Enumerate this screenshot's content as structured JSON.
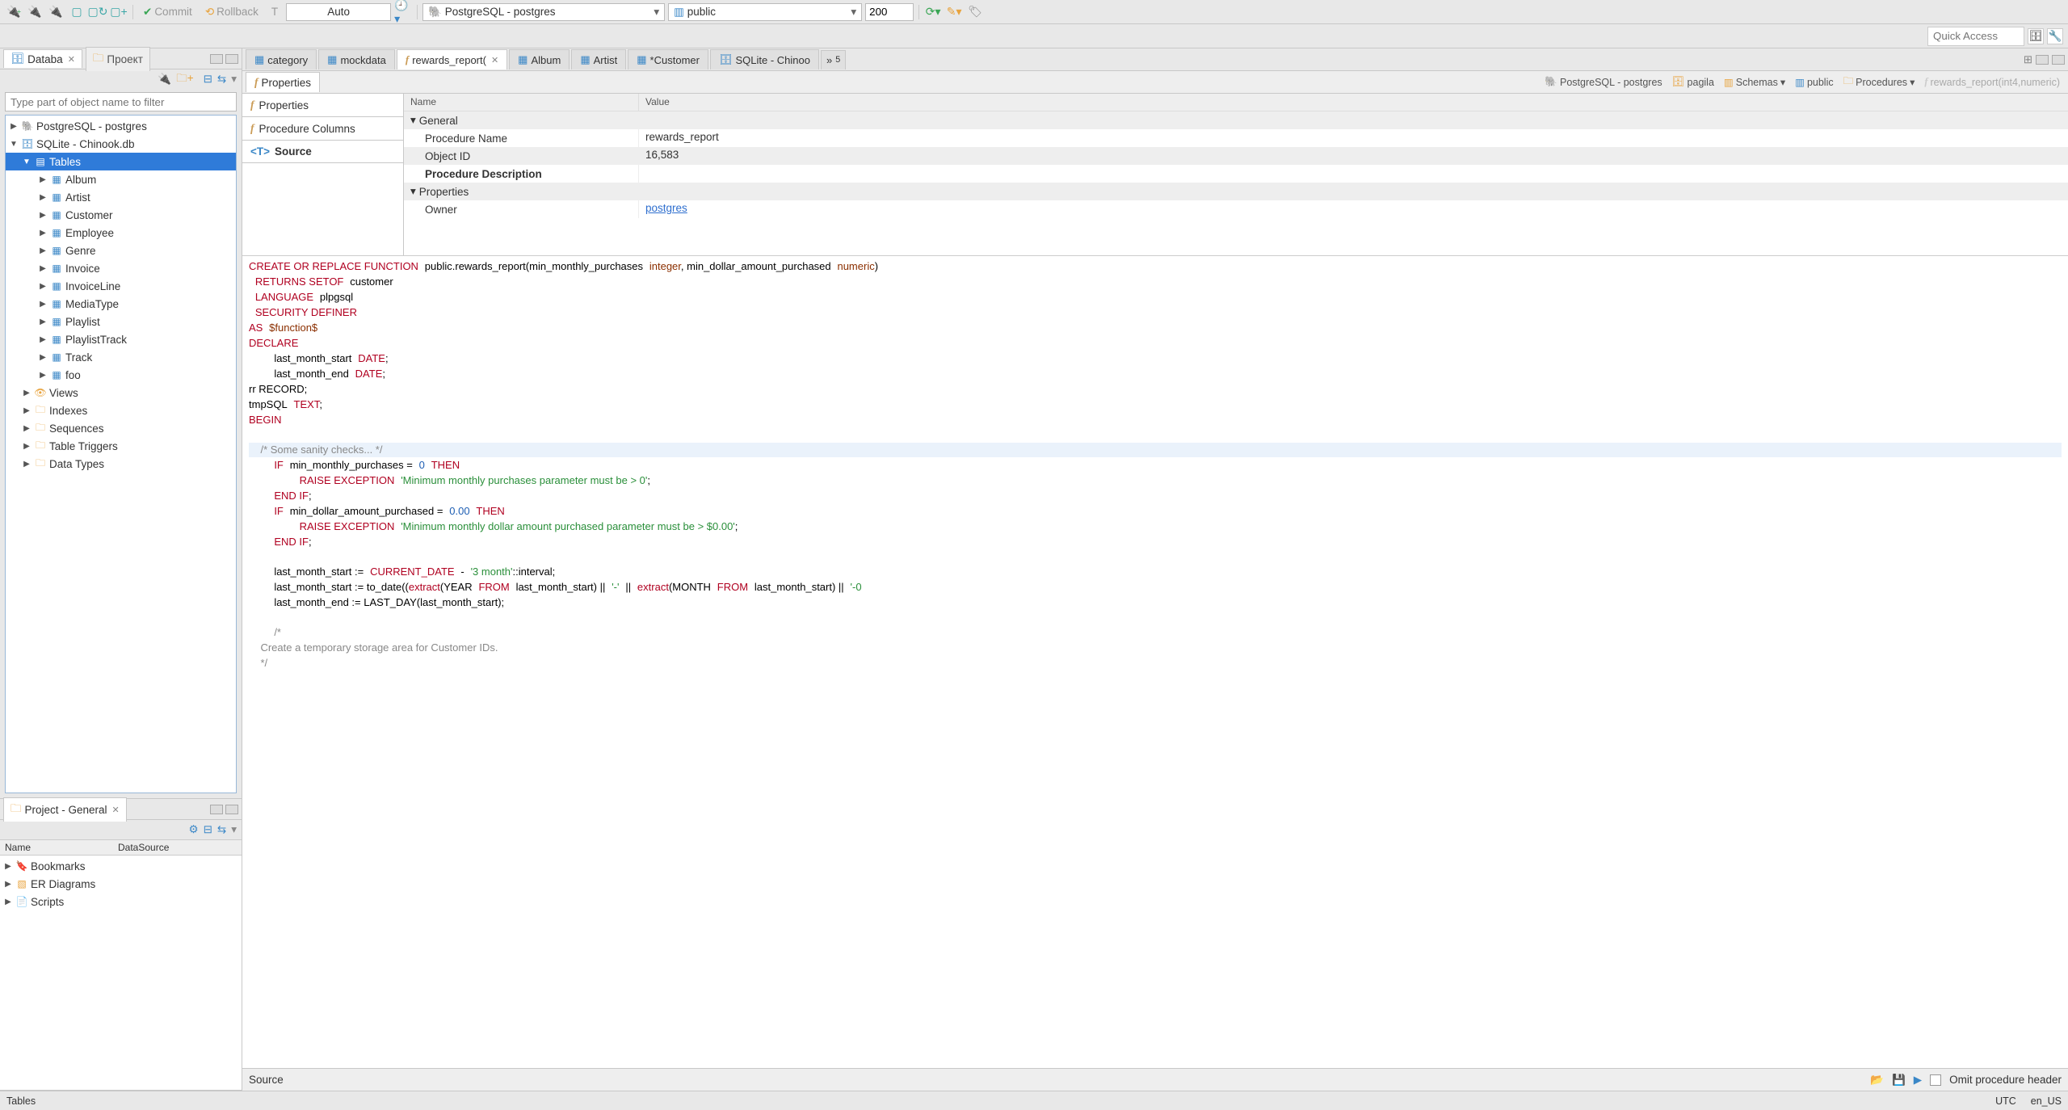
{
  "toolbar": {
    "commit_label": "Commit",
    "rollback_label": "Rollback",
    "tx_label": "T",
    "mode_combo": "Auto",
    "datasource_combo": "PostgreSQL - postgres",
    "schema_combo": "public",
    "limit_value": "200"
  },
  "quick_access_placeholder": "Quick Access",
  "left": {
    "tab1": "Databa",
    "tab2": "Проект",
    "filter_placeholder": "Type part of object name to filter",
    "conn1": "PostgreSQL - postgres",
    "conn2": "SQLite - Chinook.db",
    "tables_label": "Tables",
    "tables": [
      "Album",
      "Artist",
      "Customer",
      "Employee",
      "Genre",
      "Invoice",
      "InvoiceLine",
      "MediaType",
      "Playlist",
      "PlaylistTrack",
      "Track",
      "foo"
    ],
    "folders": [
      "Views",
      "Indexes",
      "Sequences",
      "Table Triggers",
      "Data Types"
    ]
  },
  "project": {
    "title": "Project - General",
    "col_name": "Name",
    "col_ds": "DataSource",
    "items": [
      "Bookmarks",
      "ER Diagrams",
      "Scripts"
    ]
  },
  "editor_tabs": {
    "t0": "category",
    "t1": "mockdata",
    "t2": "rewards_report(",
    "t3": "Album",
    "t4": "Artist",
    "t5": "*Customer",
    "t6": "SQLite - Chinoo",
    "overflow": "5"
  },
  "subtab_label": "Properties",
  "breadcrumb": {
    "b0": "PostgreSQL - postgres",
    "b1": "pagila",
    "b2": "Schemas",
    "b3": "public",
    "b4": "Procedures",
    "b5": "rewards_report(int4,numeric)"
  },
  "prop_nav": {
    "n0": "Properties",
    "n1": "Procedure Columns",
    "n2": "Source"
  },
  "props": {
    "head_name": "Name",
    "head_value": "Value",
    "g_general": "General",
    "r_proc_name_k": "Procedure Name",
    "r_proc_name_v": "rewards_report",
    "r_obj_id_k": "Object ID",
    "r_obj_id_v": "16,583",
    "r_desc_k": "Procedure Description",
    "g_props": "Properties",
    "r_owner_k": "Owner",
    "r_owner_v": "postgres"
  },
  "bottom": {
    "source_tab": "Source",
    "omit_label": "Omit procedure header"
  },
  "status": {
    "left": "Tables",
    "tz": "UTC",
    "locale": "en_US"
  }
}
